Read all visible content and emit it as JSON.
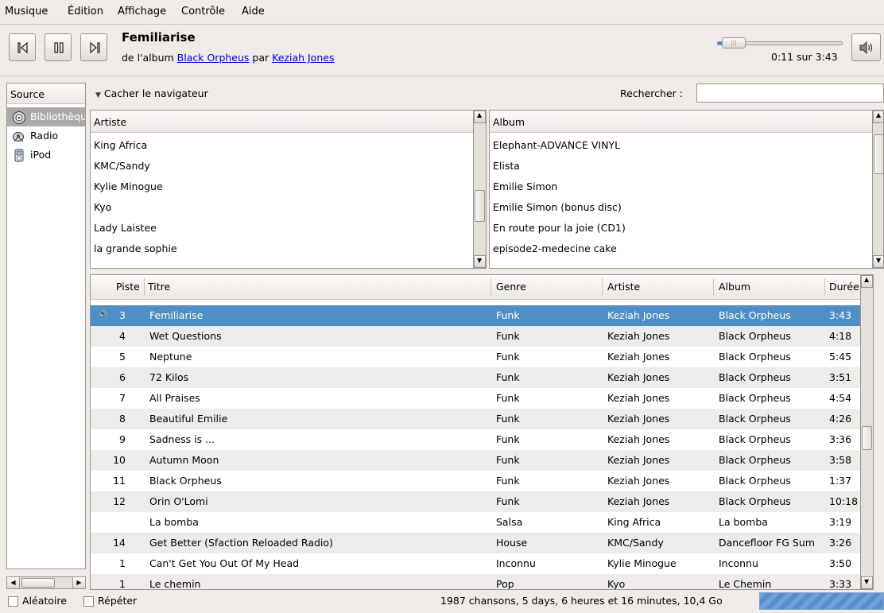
{
  "menubar": {
    "items": [
      "Musique",
      "Édition",
      "Affichage",
      "Contrôle",
      "Aide"
    ]
  },
  "player": {
    "title": "Femiliarise",
    "from_album": "de l'album",
    "album": "Black Orpheus",
    "by": "par",
    "artist": "Keziah Jones",
    "time": "0:11 sur 3:43",
    "position_fraction": 0.05
  },
  "sidebar": {
    "header": "Source",
    "items": [
      {
        "label": "Bibliothèque",
        "icon": "library-icon",
        "selected": true
      },
      {
        "label": "Radio",
        "icon": "radio-icon",
        "selected": false
      },
      {
        "label": "iPod",
        "icon": "ipod-icon",
        "selected": false
      }
    ]
  },
  "browser": {
    "toggle_label": "Cacher le navigateur",
    "search_label": "Rechercher :",
    "search_value": "",
    "artist_header": "Artiste",
    "album_header": "Album",
    "artists": [
      "King Africa",
      "KMC/Sandy",
      "Kylie Minogue",
      "Kyo",
      "Lady Laistee",
      "la grande sophie"
    ],
    "albums": [
      "Elephant-ADVANCE VINYL",
      "Elista",
      "Emilie Simon",
      "Emilie Simon (bonus disc)",
      "En route pour la joie (CD1)",
      "episode2-medecine cake"
    ]
  },
  "tracklist": {
    "columns": [
      "Piste",
      "Titre",
      "Genre",
      "Artiste",
      "Album",
      "Durée"
    ],
    "rows": [
      {
        "track": "3",
        "title": "Femiliarise",
        "genre": "Funk",
        "artist": "Keziah Jones",
        "album": "Black Orpheus",
        "duration": "3:43",
        "playing": true
      },
      {
        "track": "4",
        "title": "Wet Questions",
        "genre": "Funk",
        "artist": "Keziah Jones",
        "album": "Black Orpheus",
        "duration": "4:18"
      },
      {
        "track": "5",
        "title": "Neptune",
        "genre": "Funk",
        "artist": "Keziah Jones",
        "album": "Black Orpheus",
        "duration": "5:45"
      },
      {
        "track": "6",
        "title": "72 Kilos",
        "genre": "Funk",
        "artist": "Keziah Jones",
        "album": "Black Orpheus",
        "duration": "3:51"
      },
      {
        "track": "7",
        "title": "All Praises",
        "genre": "Funk",
        "artist": "Keziah Jones",
        "album": "Black Orpheus",
        "duration": "4:54"
      },
      {
        "track": "8",
        "title": "Beautiful Emilie",
        "genre": "Funk",
        "artist": "Keziah Jones",
        "album": "Black Orpheus",
        "duration": "4:26"
      },
      {
        "track": "9",
        "title": "Sadness is ...",
        "genre": "Funk",
        "artist": "Keziah Jones",
        "album": "Black Orpheus",
        "duration": "3:36"
      },
      {
        "track": "10",
        "title": "Autumn Moon",
        "genre": "Funk",
        "artist": "Keziah Jones",
        "album": "Black Orpheus",
        "duration": "3:58"
      },
      {
        "track": "11",
        "title": "Black Orpheus",
        "genre": "Funk",
        "artist": "Keziah Jones",
        "album": "Black Orpheus",
        "duration": "1:37"
      },
      {
        "track": "12",
        "title": "Orin O'Lomi",
        "genre": "Funk",
        "artist": "Keziah Jones",
        "album": "Black Orpheus",
        "duration": "10:18"
      },
      {
        "track": "",
        "title": "La bomba",
        "genre": "Salsa",
        "artist": "King Africa",
        "album": "La bomba",
        "duration": "3:19"
      },
      {
        "track": "14",
        "title": "Get Better (Sfaction Reloaded Radio)",
        "genre": "House",
        "artist": "KMC/Sandy",
        "album": "Dancefloor FG Sum",
        "duration": "3:26"
      },
      {
        "track": "1",
        "title": "Can't Get You Out Of My Head",
        "genre": "Inconnu",
        "artist": "Kylie Minogue",
        "album": "Inconnu",
        "duration": "3:50"
      },
      {
        "track": "1",
        "title": "Le chemin",
        "genre": "Pop",
        "artist": "Kyo",
        "album": "Le Chemin",
        "duration": "3:33"
      }
    ]
  },
  "statusbar": {
    "shuffle_label": "Aléatoire",
    "repeat_label": "Répéter",
    "summary": "1987 chansons, 5 days, 6 heures et 16 minutes, 10,4 Go"
  },
  "colors": {
    "selection": "#4e8fc5",
    "link": "#0000cc",
    "window_bg": "#efebe7"
  }
}
